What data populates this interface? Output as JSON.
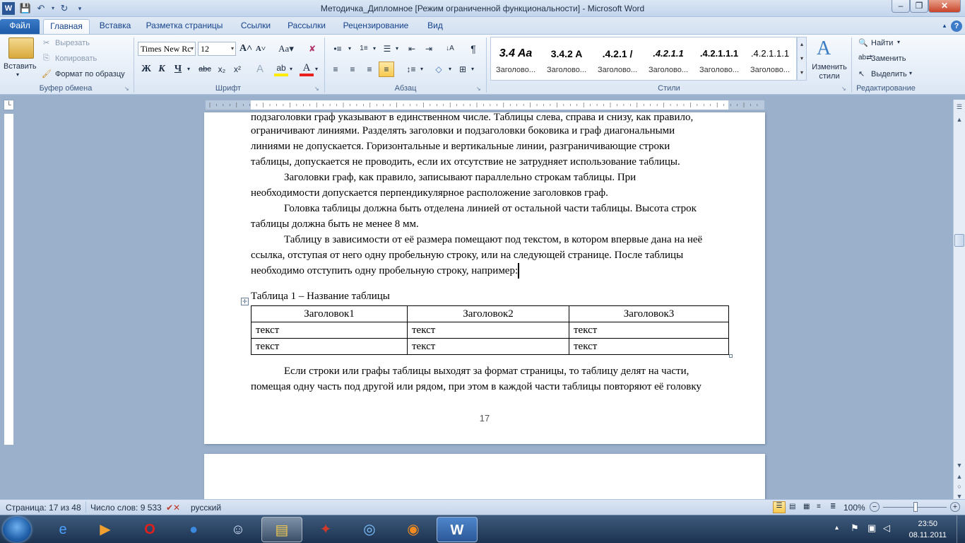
{
  "window": {
    "title": "Методичка_Дипломное [Режим ограниченной функциональности]  -  Microsoft Word"
  },
  "tabs": [
    "Файл",
    "Главная",
    "Вставка",
    "Разметка страницы",
    "Ссылки",
    "Рассылки",
    "Рецензирование",
    "Вид"
  ],
  "ribbon": {
    "clipboard": {
      "paste": "Вставить",
      "cut": "Вырезать",
      "copy": "Копировать",
      "format_painter": "Формат по образцу",
      "label": "Буфер обмена"
    },
    "font": {
      "name": "Times New Rc",
      "size": "12",
      "label": "Шрифт"
    },
    "paragraph": {
      "label": "Абзац"
    },
    "styles": {
      "label": "Стили",
      "items": [
        {
          "preview": "3.4  Aa",
          "name": "Заголово..."
        },
        {
          "preview": "3.4.2  A",
          "name": "Заголово..."
        },
        {
          "preview": ".4.2.1  /",
          "name": "Заголово..."
        },
        {
          "preview": ".4.2.1.1",
          "name": "Заголово..."
        },
        {
          "preview": ".4.2.1.1.1",
          "name": "Заголово..."
        },
        {
          "preview": ".4.2.1.1.1",
          "name": "Заголово..."
        }
      ],
      "change_styles": "Изменить стили"
    },
    "editing": {
      "label": "Редактирование",
      "find": "Найти",
      "replace": "Заменить",
      "select": "Выделить"
    }
  },
  "document": {
    "paragraphs": [
      "подзаголовки граф указывают в единственном числе. Таблицы слева, справа и снизу, как правило,",
      "ограничивают линиями. Разделять заголовки и подзаголовки боковика и граф диагональными",
      "линиями не допускается. Горизонтальные и вертикальные линии, разграничивающие строки",
      "таблицы, допускается не проводить, если их отсутствие не затрудняет использование таблицы.",
      "Заголовки граф, как правило, записывают параллельно строкам таблицы. При",
      "необходимости допускается перпендикулярное расположение заголовков граф.",
      "Головка таблицы должна быть отделена линией от остальной части таблицы. Высота строк",
      "таблицы должна быть не менее 8 мм.",
      "Таблицу в зависимости от её размера помещают под текстом, в котором впервые дана на неё",
      "ссылка, отступая от него одну пробельную строку, или на следующей странице. После таблицы",
      "необходимо отступить одну пробельную строку, например:"
    ],
    "table_caption": "Таблица 1 – Название таблицы",
    "table": {
      "headers": [
        "Заголовок1",
        "Заголовок2",
        "Заголовок3"
      ],
      "rows": [
        [
          "текст",
          "текст",
          "текст"
        ],
        [
          "текст",
          "текст",
          "текст"
        ]
      ]
    },
    "after_table": [
      "Если строки или графы таблицы выходят за формат страницы, то таблицу делят на части,",
      "помещая одну часть под другой или рядом, при этом в каждой части таблицы повторяют её головку"
    ],
    "page_number": "17"
  },
  "statusbar": {
    "page": "Страница: 17 из 48",
    "words": "Число слов: 9 533",
    "language": "русский",
    "zoom": "100%"
  },
  "taskbar": {
    "time": "23:50",
    "date": "08.11.2011"
  },
  "colors": {
    "file_tab": "#1d5aa8",
    "ribbon_bg": "#dbe6f4",
    "doc_bg": "#9bb0ca"
  }
}
